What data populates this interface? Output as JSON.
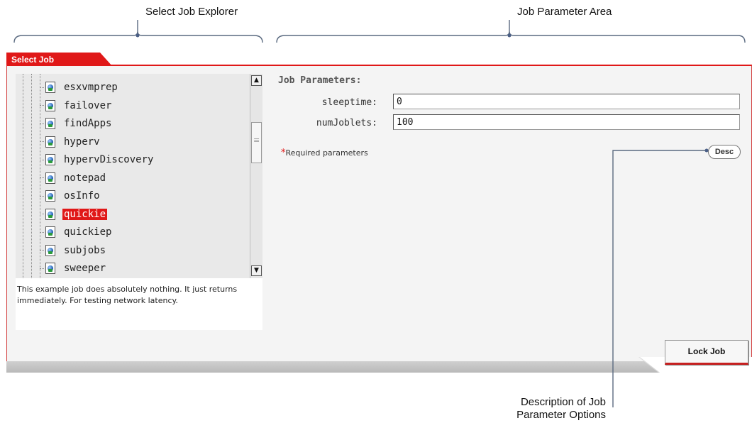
{
  "callouts": {
    "explorer": "Select Job Explorer",
    "params_area": "Job Parameter Area",
    "desc_line1": "Description of Job",
    "desc_line2": "Parameter Options"
  },
  "tab": {
    "label": "Select Job"
  },
  "explorer": {
    "items": [
      {
        "label": "esxvmprep"
      },
      {
        "label": "failover"
      },
      {
        "label": "findApps"
      },
      {
        "label": "hyperv"
      },
      {
        "label": "hypervDiscovery"
      },
      {
        "label": "notepad"
      },
      {
        "label": "osInfo"
      },
      {
        "label": "quickie",
        "selected": true
      },
      {
        "label": "quickiep"
      },
      {
        "label": "subjobs"
      },
      {
        "label": "sweeper"
      }
    ],
    "description": "This example job does absolutely nothing. It just returns immediately. For testing network latency."
  },
  "params": {
    "heading": "Job Parameters:",
    "fields": [
      {
        "label": "sleeptime:",
        "value": "0"
      },
      {
        "label": "numJoblets:",
        "value": "100"
      }
    ],
    "required_star": "*",
    "required_text": "Required parameters",
    "desc_button": "Desc"
  },
  "actions": {
    "lock_job": "Lock Job"
  },
  "colors": {
    "accent": "#e01818",
    "panel_bg": "#f4f4f4",
    "tree_bg": "#e9e9e9"
  }
}
